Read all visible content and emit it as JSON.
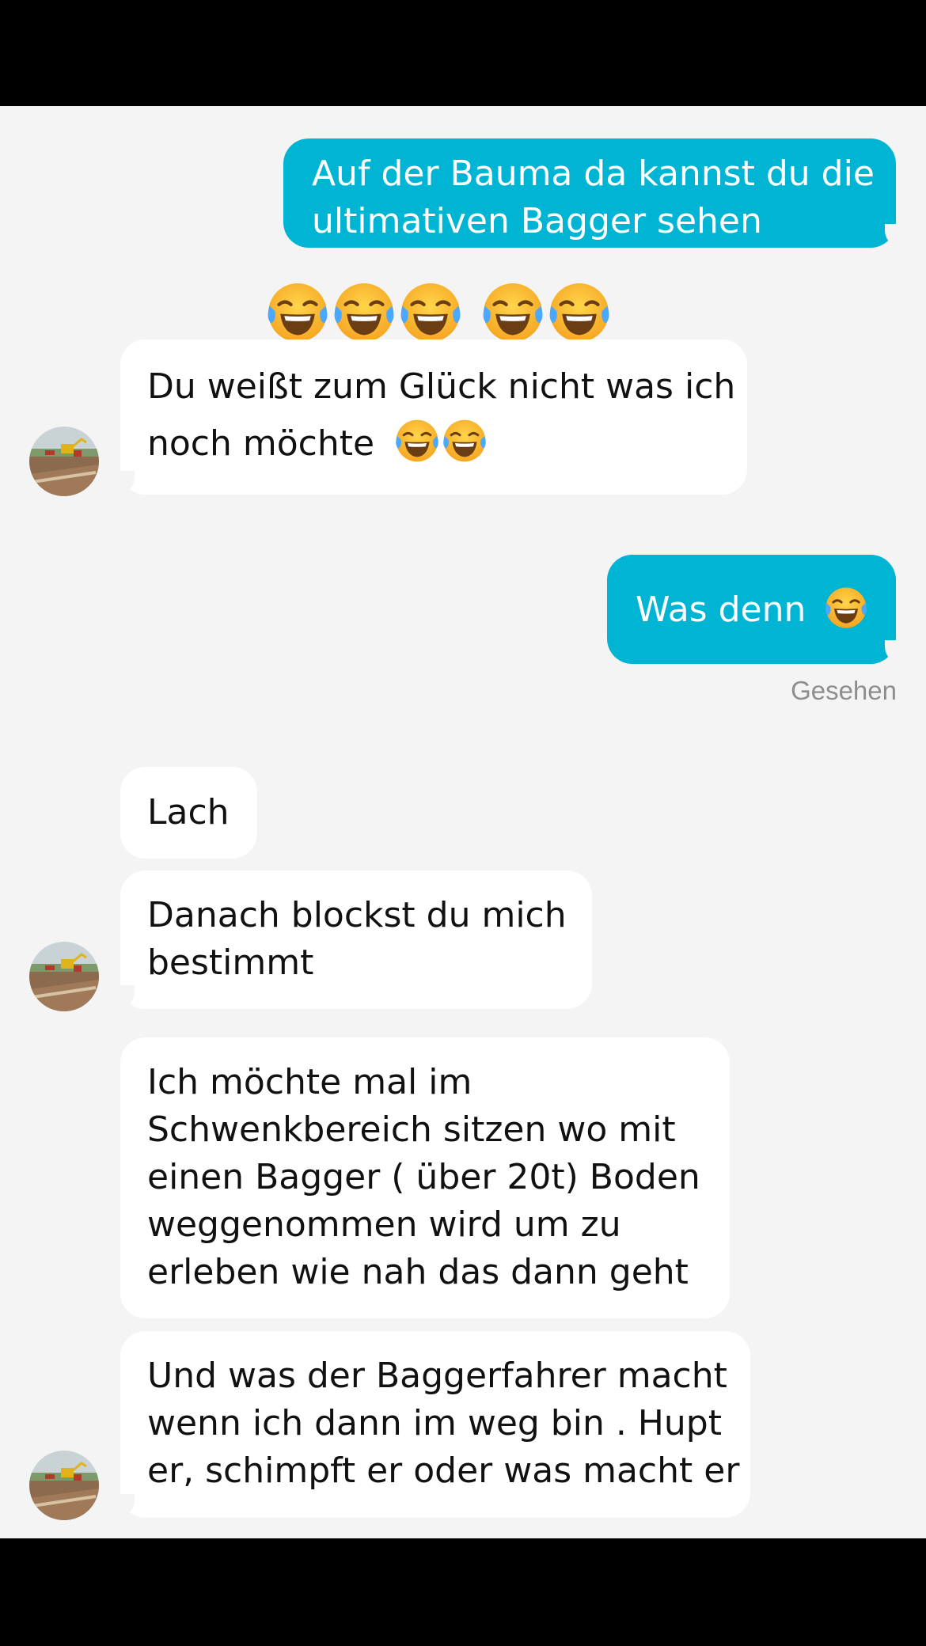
{
  "colors": {
    "outgoing_bubble": "#00b5d3",
    "incoming_bubble": "#ffffff",
    "background": "#f4f4f4",
    "seen_text": "#8e8e8e"
  },
  "messages": [
    {
      "id": "m1",
      "direction": "outgoing",
      "lines": [
        "Auf der Bauma da kannst du die",
        "ultimativen Bagger sehen"
      ]
    },
    {
      "id": "m2",
      "direction": "incoming",
      "reaction_line_emojis": "😂😂😂 😂😂",
      "lines": [
        "Du weißt zum Glück nicht was ich",
        "noch möchte"
      ],
      "trailing_emojis": "😂😂"
    },
    {
      "id": "m3",
      "direction": "outgoing",
      "lines": [
        "Was denn"
      ],
      "trailing_emojis": "😂",
      "status": "Gesehen"
    },
    {
      "id": "m4",
      "direction": "incoming",
      "lines": [
        "Lach"
      ]
    },
    {
      "id": "m5",
      "direction": "incoming",
      "lines": [
        "Danach blockst du mich",
        "bestimmt"
      ]
    },
    {
      "id": "m6",
      "direction": "incoming",
      "lines": [
        "Ich möchte mal im",
        "Schwenkbereich sitzen wo mit",
        "einen Bagger ( über 20t) Boden",
        "weggenommen wird um zu",
        "erleben wie nah das dann geht"
      ]
    },
    {
      "id": "m7",
      "direction": "incoming",
      "lines": [
        "Und was der Baggerfahrer macht",
        "wenn ich dann im weg bin . Hupt",
        "er, schimpft er oder was macht er"
      ]
    }
  ],
  "avatar": {
    "icon": "excavator-photo-avatar"
  },
  "emoji_icon": "face-with-tears-of-joy-icon"
}
